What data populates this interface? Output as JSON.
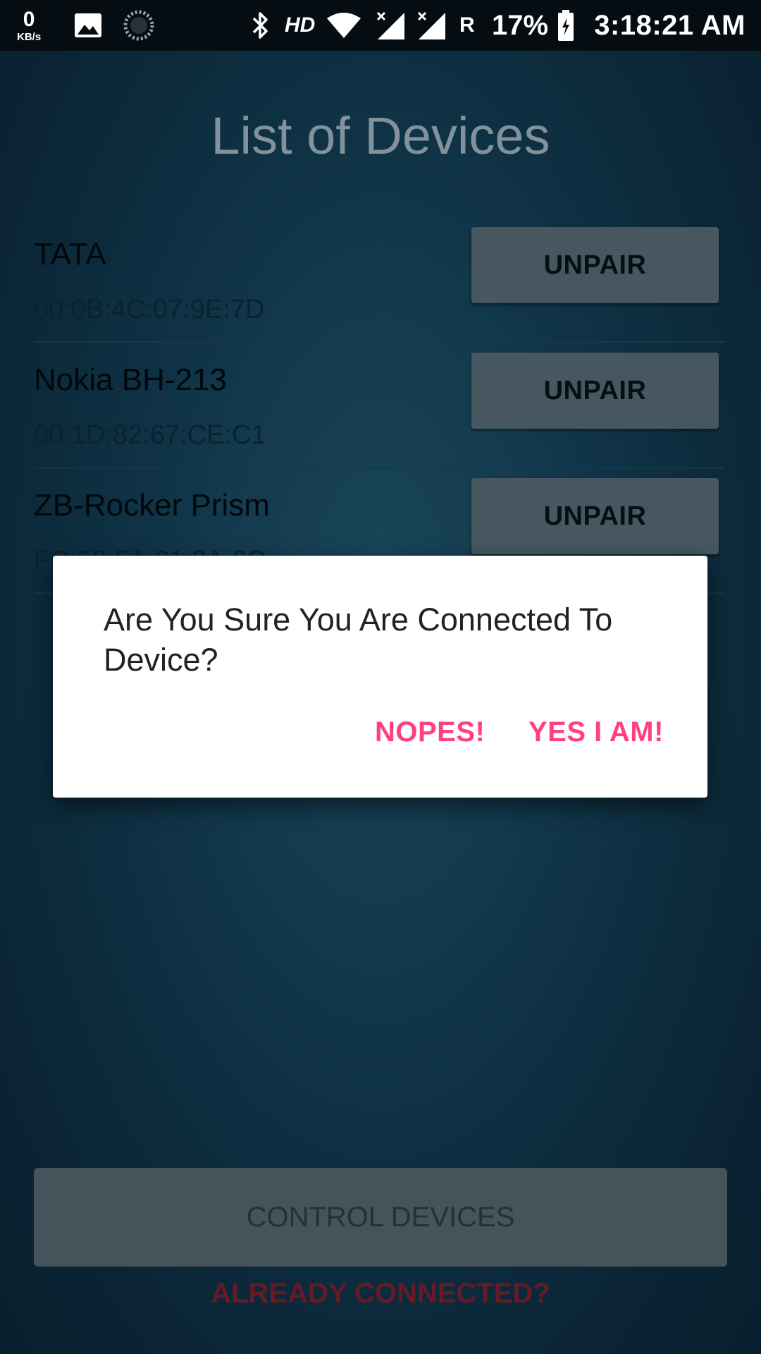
{
  "status_bar": {
    "net_speed_value": "0",
    "net_speed_unit": "KB/s",
    "hd_label": "HD",
    "roaming_label": "R",
    "battery_percent": "17%",
    "time": "3:18:21 AM",
    "icons": [
      "image-icon",
      "sync-icon",
      "bluetooth-icon",
      "wifi-icon",
      "signal-icon",
      "signal-icon",
      "battery-charging-icon"
    ]
  },
  "page": {
    "title": "List of Devices"
  },
  "devices": [
    {
      "name": "TATA",
      "address": "00:0B:4C:07:9E:7D",
      "button_label": "UNPAIR"
    },
    {
      "name": "Nokia BH-213",
      "address": "00:1D:82:67:CE:C1",
      "button_label": "UNPAIR"
    },
    {
      "name": "ZB-Rocker Prism",
      "address": "FC:58:FA:01:2A:6C",
      "button_label": "UNPAIR"
    }
  ],
  "footer": {
    "control_button_label": "CONTROL DEVICES",
    "already_connected_link": "ALREADY CONNECTED?"
  },
  "dialog": {
    "message": "Are You Sure You Are Connected To Device?",
    "negative_label": "NOPES!",
    "positive_label": "YES I AM!"
  },
  "colors": {
    "accent": "#ff4081",
    "background": "#123a4f",
    "button_gray": "#4d5f69",
    "link_dim_red": "#6e1e2a"
  }
}
